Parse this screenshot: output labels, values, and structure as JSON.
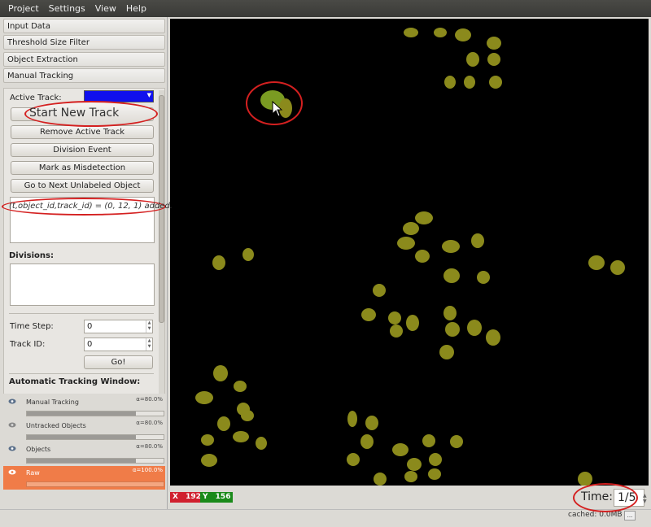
{
  "menu": [
    "Project",
    "Settings",
    "View",
    "Help"
  ],
  "applets": {
    "input_data": "Input Data",
    "threshold": "Threshold  Size Filter",
    "object_extraction": "Object Extraction",
    "manual_tracking": "Manual Tracking"
  },
  "tracking": {
    "active_track_label": "Active Track:",
    "active_track_color": "#1010ee",
    "buttons": {
      "start_new_track": "Start New Track",
      "remove_active_track": "Remove Active Track",
      "division_event": "Division Event",
      "mark_misdetection": "Mark as Misdetection",
      "next_unlabeled": "Go to Next Unlabeled Object"
    },
    "log_message": "(t,object_id,track_id) = (0, 12, 1) added.",
    "divisions_label": "Divisions:",
    "time_step_label": "Time Step:",
    "time_step_value": "0",
    "track_id_label": "Track ID:",
    "track_id_value": "0",
    "go_button": "Go!",
    "auto_window_label": "Automatic Tracking Window:"
  },
  "layers": [
    {
      "name": "Manual Tracking",
      "alpha": "α=80.0%",
      "opacity": 0.8,
      "selected": false
    },
    {
      "name": "Untracked Objects",
      "alpha": "α=80.0%",
      "opacity": 0.8,
      "selected": false
    },
    {
      "name": "Objects",
      "alpha": "α=80.0%",
      "opacity": 0.8,
      "selected": false
    },
    {
      "name": "Raw",
      "alpha": "α=100.0%",
      "opacity": 1.0,
      "selected": true
    }
  ],
  "status": {
    "x_label": "X",
    "x_value": "192",
    "y_label": "Y",
    "y_value": "156",
    "x_color": "#d0202e",
    "y_color": "#1a8a1a",
    "time_label": "Time:",
    "time_value": "1/5",
    "cached_text": "cached: 0.0MB",
    "more_button": "..."
  },
  "icons": {
    "eye": "eye-icon",
    "layer_up": "arrow-up-icon",
    "layer_down": "arrow-down-icon",
    "layer_settings": "layer-settings-icon",
    "cursor": "mouse-pointer-icon"
  },
  "colors": {
    "object_fill": "#8b8a1c",
    "active_object_fill": "#7a9b22",
    "highlight": "#d42020",
    "selected_layer": "#f07c48"
  }
}
